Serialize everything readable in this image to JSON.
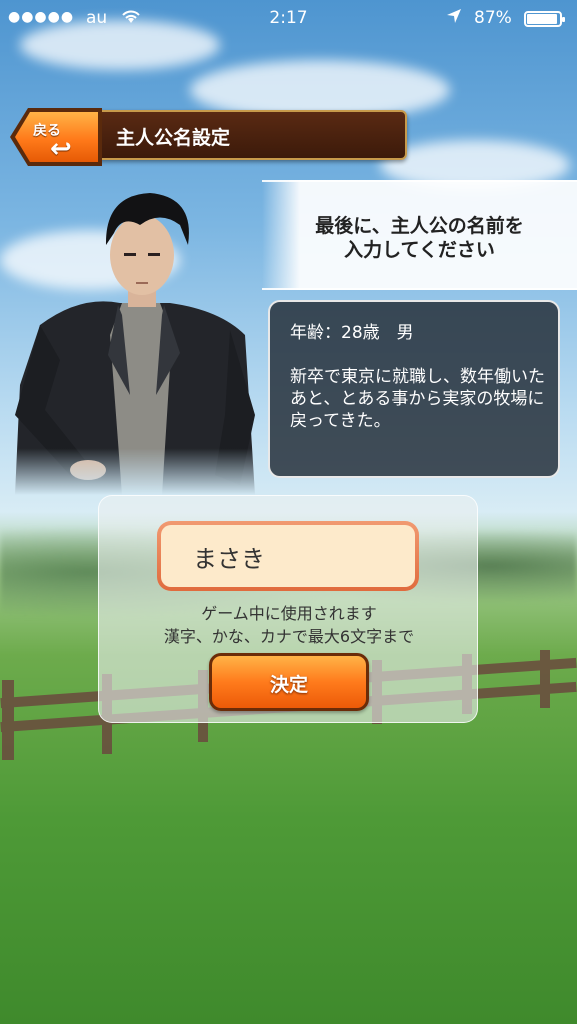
{
  "status_bar": {
    "signal": "●●●●●",
    "carrier": "au",
    "time": "2:17",
    "battery": "87%"
  },
  "header": {
    "back_label": "戻る",
    "title": "主人公名設定"
  },
  "message": {
    "line1": "最後に、主人公の名前を",
    "line2": "入力してください"
  },
  "profile": {
    "age_gender": "年齢：28歳　男",
    "description": "新卒で東京に就職し、数年働いたあと、とある事から実家の牧場に戻ってきた。"
  },
  "name_form": {
    "value": "まさき",
    "hint_line1": "ゲーム中に使用されます",
    "hint_line2": "漢字、かな、カナで最大6文字まで",
    "confirm_label": "決定"
  },
  "colors": {
    "accent_orange": "#ff7b1c",
    "title_bar_brown": "#4a200e"
  }
}
